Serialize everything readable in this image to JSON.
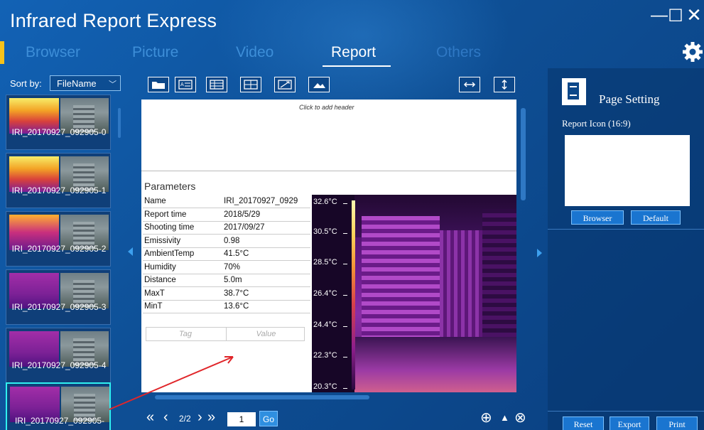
{
  "window": {
    "title": "Infrared Report Express",
    "controls": {
      "minimize": "—",
      "maximize": "☐",
      "close": "✕"
    }
  },
  "nav": {
    "tabs": [
      "Browser",
      "Picture",
      "Video",
      "Report",
      "Others"
    ],
    "active": "Report"
  },
  "sidebar": {
    "sort_label": "Sort by:",
    "sort_value": "FileName",
    "thumbnails": [
      {
        "name": "IRI_20170927_092905-0"
      },
      {
        "name": "IRI_20170927_092905-1"
      },
      {
        "name": "IRI_20170927_092905-2"
      },
      {
        "name": "IRI_20170927_092905-3"
      },
      {
        "name": "IRI_20170927_092905-4"
      },
      {
        "name": "IRI_20170927_092905-",
        "selected": true
      }
    ]
  },
  "toolbar": {
    "icons": [
      "folder-icon",
      "text-box-icon",
      "table-icon",
      "grid-icon",
      "line-icon",
      "image-icon",
      "fit-width-icon",
      "fit-height-icon"
    ]
  },
  "report": {
    "header_hint": "Click to add header",
    "params_title": "Parameters",
    "params": [
      {
        "key": "Name",
        "value": "IRI_20170927_0929"
      },
      {
        "key": "Report time",
        "value": "2018/5/29"
      },
      {
        "key": "Shooting time",
        "value": "2017/09/27"
      },
      {
        "key": "Emissivity",
        "value": "0.98"
      },
      {
        "key": "AmbientTemp",
        "value": "41.5°C"
      },
      {
        "key": "Humidity",
        "value": "70%"
      },
      {
        "key": "Distance",
        "value": "5.0m"
      },
      {
        "key": "MaxT",
        "value": "38.7°C"
      },
      {
        "key": "MinT",
        "value": "13.6°C"
      }
    ],
    "tag_placeholder": "Tag",
    "value_placeholder": "Value",
    "scale": [
      "32.6°C",
      "30.5°C",
      "28.5°C",
      "26.4°C",
      "24.4°C",
      "22.3°C",
      "20.3°C"
    ]
  },
  "pager": {
    "first": "«",
    "prev": "‹",
    "page": "2/2",
    "next": "›",
    "last": "»",
    "input": "1",
    "go": "Go"
  },
  "zoom": {
    "in": "⊕",
    "up": "▲",
    "out": "⊗"
  },
  "page_setting": {
    "title": "Page Setting",
    "report_icon_label": "Report Icon (16:9)",
    "browser_btn": "Browser",
    "default_btn": "Default",
    "reset_btn": "Reset",
    "export_btn": "Export",
    "print_btn": "Print"
  },
  "colors": {
    "background": "#0e4f95",
    "accent": "#f6c21a",
    "selected_border": "#2ff0f0"
  }
}
